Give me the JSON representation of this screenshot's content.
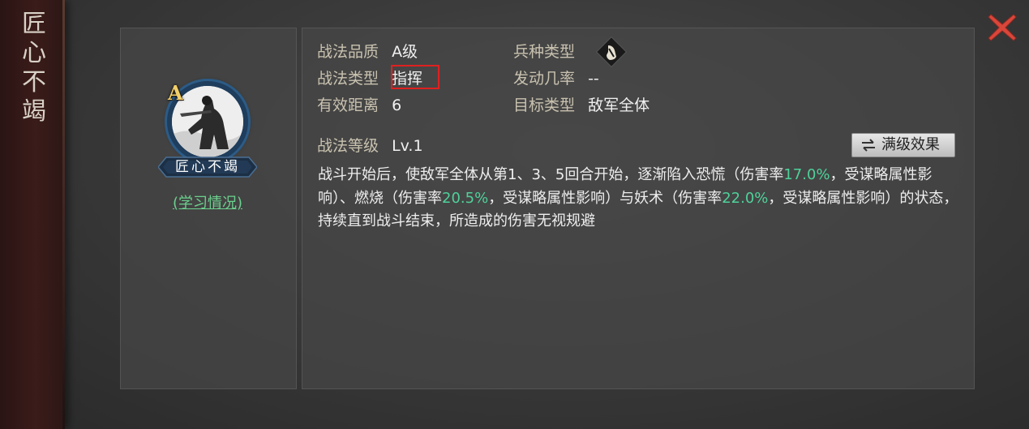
{
  "skill": {
    "name": "匠心不竭",
    "grade_badge": "A",
    "learn_link": "(学习情况)"
  },
  "attributes": {
    "quality_label": "战法品质",
    "quality_value": "A级",
    "type_label": "战法类型",
    "type_value": "指挥",
    "range_label": "有效距离",
    "range_value": "6",
    "unit_type_label": "兵种类型",
    "unit_type_icon": "cavalry-shield-icon",
    "trigger_label": "发动几率",
    "trigger_value": "--",
    "target_label": "目标类型",
    "target_value": "敌军全体"
  },
  "level": {
    "label": "战法等级",
    "value": "Lv.1",
    "max_button": "满级效果"
  },
  "description": {
    "p1": "战斗开始后，使敌军全体从第1、3、5回合开始，逐渐陷入恐慌（伤害率",
    "v1": "17.0%",
    "p2": "，受谋略属性影响）、燃烧（伤害率",
    "v2": "20.5%",
    "p3": "，受谋略属性影响）与妖术（伤害率",
    "v3": "22.0%",
    "p4": "，受谋略属性影响）的状态，持续直到战斗结束，所造成的伤害无视规避"
  },
  "colors": {
    "highlight": "#4fd19a",
    "link": "#6bd08e",
    "close": "#d9463a",
    "grade": "#f2cf6a"
  }
}
